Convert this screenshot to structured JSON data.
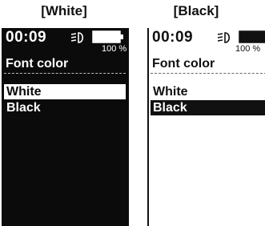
{
  "captions": {
    "left": "[White]",
    "right": "[Black]"
  },
  "colors": {
    "dark": "#0b0b0b",
    "light": "#ffffff"
  },
  "screens": [
    {
      "theme": "white",
      "status": {
        "time": "00:09",
        "battery_percent": "100 %",
        "icons": [
          "headlight-icon",
          "battery-icon"
        ]
      },
      "title": "Font color",
      "options": [
        "White",
        "Black"
      ],
      "selected": "White"
    },
    {
      "theme": "black",
      "status": {
        "time": "00:09",
        "battery_percent": "100 %",
        "icons": [
          "headlight-icon",
          "battery-icon"
        ]
      },
      "title": "Font color",
      "options": [
        "White",
        "Black"
      ],
      "selected": "Black"
    }
  ]
}
